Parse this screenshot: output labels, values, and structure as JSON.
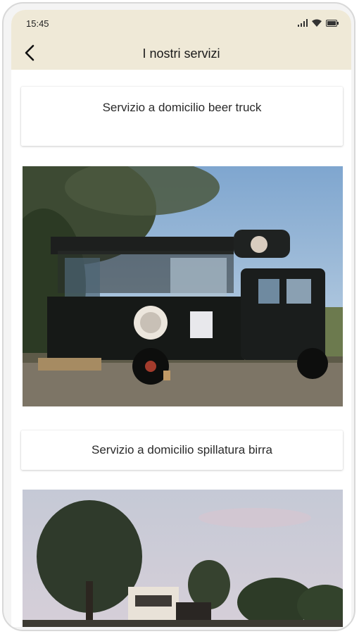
{
  "status_bar": {
    "time": "15:45"
  },
  "header": {
    "title": "I nostri servizi"
  },
  "services": [
    {
      "label": "Servizio a domicilio beer truck"
    },
    {
      "label": "Servizio a domicilio spillatura birra"
    }
  ],
  "colors": {
    "header_bg": "#efe9d7",
    "card_bg": "#ffffff"
  }
}
